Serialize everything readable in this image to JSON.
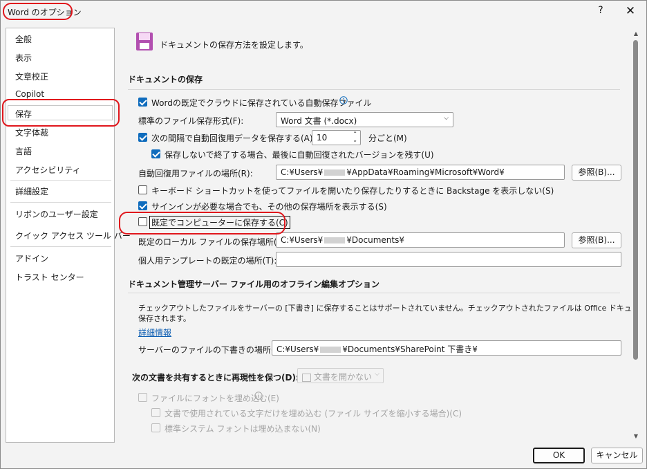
{
  "window": {
    "title": "Word のオプション",
    "help_label": "?",
    "close_label": "✕"
  },
  "sidebar": {
    "items": [
      {
        "label": "全般"
      },
      {
        "label": "表示"
      },
      {
        "label": "文章校正"
      },
      {
        "label": "Copilot"
      },
      {
        "label": "保存"
      },
      {
        "label": "文字体裁"
      },
      {
        "label": "言語"
      },
      {
        "label": "アクセシビリティ"
      },
      {
        "label": "詳細設定"
      },
      {
        "label": "リボンのユーザー設定"
      },
      {
        "label": "クイック アクセス ツール バー"
      },
      {
        "label": "アドイン"
      },
      {
        "label": "トラスト センター"
      }
    ],
    "selected": "保存"
  },
  "header": {
    "icon": "floppy-save-icon",
    "text": "ドキュメントの保存方法を設定します。"
  },
  "doc_save": {
    "heading": "ドキュメントの保存",
    "autosave_cloud": {
      "label": "Wordの既定でクラウドに保存されている自動保存ファイル",
      "checked": true,
      "info_icon": "info-icon"
    },
    "default_format": {
      "label": "標準のファイル保存形式(F):",
      "value": "Word 文書 (*.docx)"
    },
    "autorecover": {
      "label": "次の間隔で自動回復用データを保存する(A):",
      "checked": true,
      "minutes": "10",
      "unit": "分ごと(M)"
    },
    "keep_last": {
      "label": "保存しないで終了する場合、最後に自動回復されたバージョンを残す(U)",
      "checked": true
    },
    "autorecover_location": {
      "label": "自動回復用ファイルの場所(R):",
      "value_prefix": "C:¥Users¥",
      "value_suffix": "¥AppData¥Roaming¥Microsoft¥Word¥",
      "browse": "参照(B)..."
    },
    "backstage": {
      "label": "キーボード ショートカットを使ってファイルを開いたり保存したりするときに Backstage を表示しない(S)",
      "checked": false
    },
    "show_locations": {
      "label": "サインインが必要な場合でも、その他の保存場所を表示する(S)",
      "checked": true
    },
    "save_to_computer": {
      "label": "既定でコンピューターに保存する(C)",
      "checked": false
    },
    "local_location": {
      "label": "既定のローカル ファイルの保存場所(I):",
      "value_prefix": "C:¥Users¥",
      "value_suffix": "¥Documents¥",
      "browse": "参照(B)..."
    },
    "template_location": {
      "label": "個人用テンプレートの既定の場所(T):",
      "value": ""
    }
  },
  "offline": {
    "heading": "ドキュメント管理サーバー ファイル用のオフライン編集オプション",
    "description_line1": "チェックアウトしたファイルをサーバーの [下書き] に保存することはサポートされていません。チェックアウトされたファイルは Office ドキュメント キャッシュに",
    "description_line2": "保存されます。",
    "link": "詳細情報",
    "drafts_location": {
      "label": "サーバーのファイルの下書きの場所(V):",
      "value_prefix": "C:¥Users¥",
      "value_suffix": "¥Documents¥SharePoint 下書き¥"
    }
  },
  "fidelity": {
    "heading": "次の文書を共有するときに再現性を保つ(D):",
    "doc_select": "文書を開かない",
    "embed_fonts": {
      "label": "ファイルにフォントを埋め込む(E)",
      "checked": false,
      "disabled": true
    },
    "embed_used_only": {
      "label": "文書で使用されている文字だけを埋め込む (ファイル サイズを縮小する場合)(C)",
      "checked": false,
      "disabled": true
    },
    "no_common_fonts": {
      "label": "標準システム フォントは埋め込まない(N)",
      "checked": false,
      "disabled": true
    }
  },
  "footer": {
    "ok": "OK",
    "cancel": "キャンセル"
  },
  "colors": {
    "accent": "#0f6cbd",
    "highlight_circle": "#e0161c",
    "save_icon": "#b24fb0"
  }
}
